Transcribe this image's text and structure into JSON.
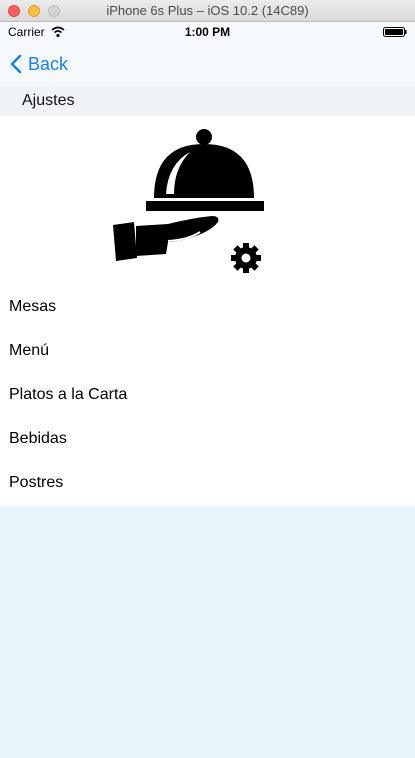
{
  "window": {
    "title": "iPhone 6s Plus – iOS 10.2 (14C89)"
  },
  "status_bar": {
    "carrier": "Carrier",
    "time": "1:00 PM"
  },
  "navbar": {
    "back_label": "Back"
  },
  "section": {
    "title": "Ajustes"
  },
  "menu": {
    "items": [
      {
        "label": "Mesas"
      },
      {
        "label": "Menú"
      },
      {
        "label": "Platos a la Carta"
      },
      {
        "label": "Bebidas"
      },
      {
        "label": "Postres"
      }
    ]
  },
  "icons": {
    "logo": "waiter-cloche-gear-icon",
    "back": "chevron-left-icon",
    "wifi": "wifi-icon",
    "battery": "battery-icon"
  },
  "colors": {
    "accent": "#1a7ff2",
    "background": "#e8f5fd",
    "bars": "#f6f9fb"
  }
}
